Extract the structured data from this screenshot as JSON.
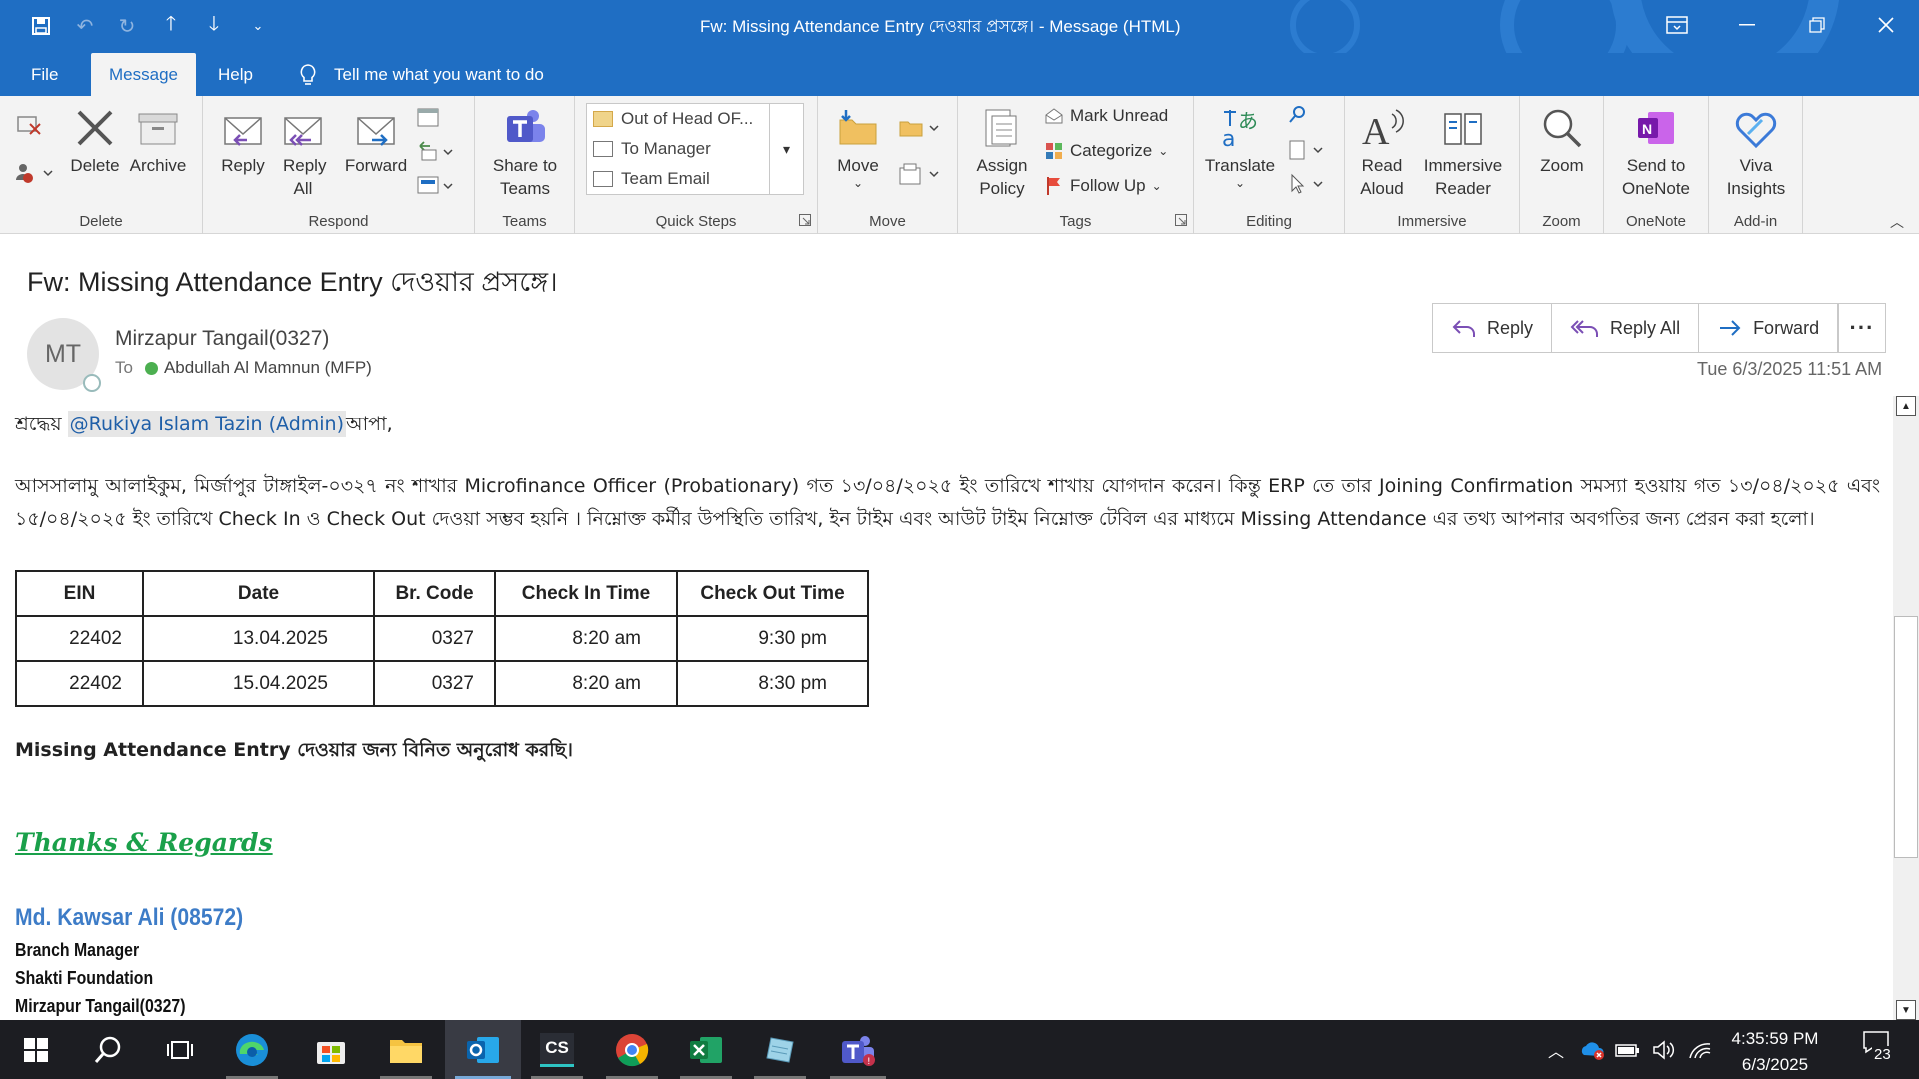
{
  "window": {
    "title": "Fw: Missing Attendance Entry দেওয়ার প্রসঙ্গে।  -  Message (HTML)"
  },
  "menu": {
    "tabs": [
      "File",
      "Message",
      "Help"
    ],
    "active_tab": "Message",
    "tell_me": "Tell me what you want to do"
  },
  "ribbon": {
    "delete_group": {
      "label": "Delete",
      "delete": "Delete",
      "archive": "Archive"
    },
    "respond_group": {
      "label": "Respond",
      "reply": "Reply",
      "reply_all": "Reply All",
      "forward": "Forward"
    },
    "teams_group": {
      "label": "Teams",
      "share": "Share to Teams"
    },
    "quick_steps": {
      "label": "Quick Steps",
      "items": [
        "Out of Head OF...",
        "To Manager",
        "Team Email"
      ]
    },
    "move_group": {
      "label": "Move",
      "move": "Move"
    },
    "tags_group": {
      "label": "Tags",
      "assign_policy": "Assign Policy",
      "mark_unread": "Mark Unread",
      "categorize": "Categorize",
      "follow_up": "Follow Up"
    },
    "editing_group": {
      "label": "Editing",
      "translate": "Translate"
    },
    "immersive_group": {
      "label": "Immersive",
      "read_aloud": "Read Aloud",
      "immersive_reader": "Immersive Reader"
    },
    "zoom_group": {
      "label": "Zoom",
      "zoom": "Zoom"
    },
    "onenote_group": {
      "label": "OneNote",
      "send": "Send to OneNote"
    },
    "addin_group": {
      "label": "Add-in",
      "viva": "Viva Insights"
    }
  },
  "message": {
    "subject": "Fw: Missing Attendance Entry দেওয়ার প্রসঙ্গে।",
    "avatar_initials": "MT",
    "sender": "Mirzapur Tangail(0327)",
    "to_label": "To",
    "recipient": "Abdullah Al Mamnun (MFP)",
    "actions": {
      "reply": "Reply",
      "reply_all": "Reply All",
      "forward": "Forward",
      "more": "···"
    },
    "datetime": "Tue 6/3/2025 11:51 AM"
  },
  "body": {
    "greeting_prefix": "শ্রদ্ধেয় ",
    "mention": "@Rukiya Islam Tazin (Admin)",
    "greeting_suffix": "আপা,",
    "paragraph": "আসসালামু আলাইকুম, মির্জাপুর টাঙ্গাইল-০৩২৭ নং শাখার Microfinance Officer (Probationary) গত ১৩/০৪/২০২৫ ইং তারিখে শাখায় যোগদান করেন। কিন্তু ERP তে তার Joining Confirmation সমস্যা হওয়ায় গত ১৩/০৪/২০২৫ এবং ১৫/০৪/২০২৫ ইং তারিখে Check In ও Check Out দেওয়া সম্ভব হয়নি । নিম্নোক্ত কর্মীর উপস্থিতি তারিখ, ইন টাইম এবং আউট টাইম নিম্নোক্ত টেবিল এর মাধ্যমে Missing Attendance এর তথ্য আপনার অবগতির জন্য প্রেরন করা হলো।",
    "table": {
      "headers": [
        "EIN",
        "Date",
        "Br. Code",
        "Check In Time",
        "Check Out Time"
      ],
      "rows": [
        [
          "22402",
          "13.04.2025",
          "0327",
          "8:20 am",
          "9:30 pm"
        ],
        [
          "22402",
          "15.04.2025",
          "0327",
          "8:20 am",
          "8:30 pm"
        ]
      ]
    },
    "request": "Missing Attendance Entry দেওয়ার জন্য বিনিত অনুরোধ করছি।",
    "thanks": "Thanks & Regards",
    "signature": {
      "name": "Md. Kawsar Ali (08572)",
      "title": "Branch Manager",
      "org": "Shakti Foundation",
      "branch": "Mirzapur Tangail(0327)"
    }
  },
  "taskbar": {
    "apps": [
      "start",
      "search",
      "task-view",
      "edge",
      "store",
      "file-explorer",
      "outlook",
      "cs-app",
      "chrome",
      "excel",
      "notepad",
      "teams"
    ],
    "time": "4:35:59 PM",
    "date": "6/3/2025",
    "notification_count": "23"
  },
  "colors": {
    "titlebar": "#1f6ec3",
    "ribbon": "#f3f3f3",
    "mention_text": "#1f5fa8",
    "thanks": "#1aa04a",
    "signature_name": "#3d7cc7"
  }
}
